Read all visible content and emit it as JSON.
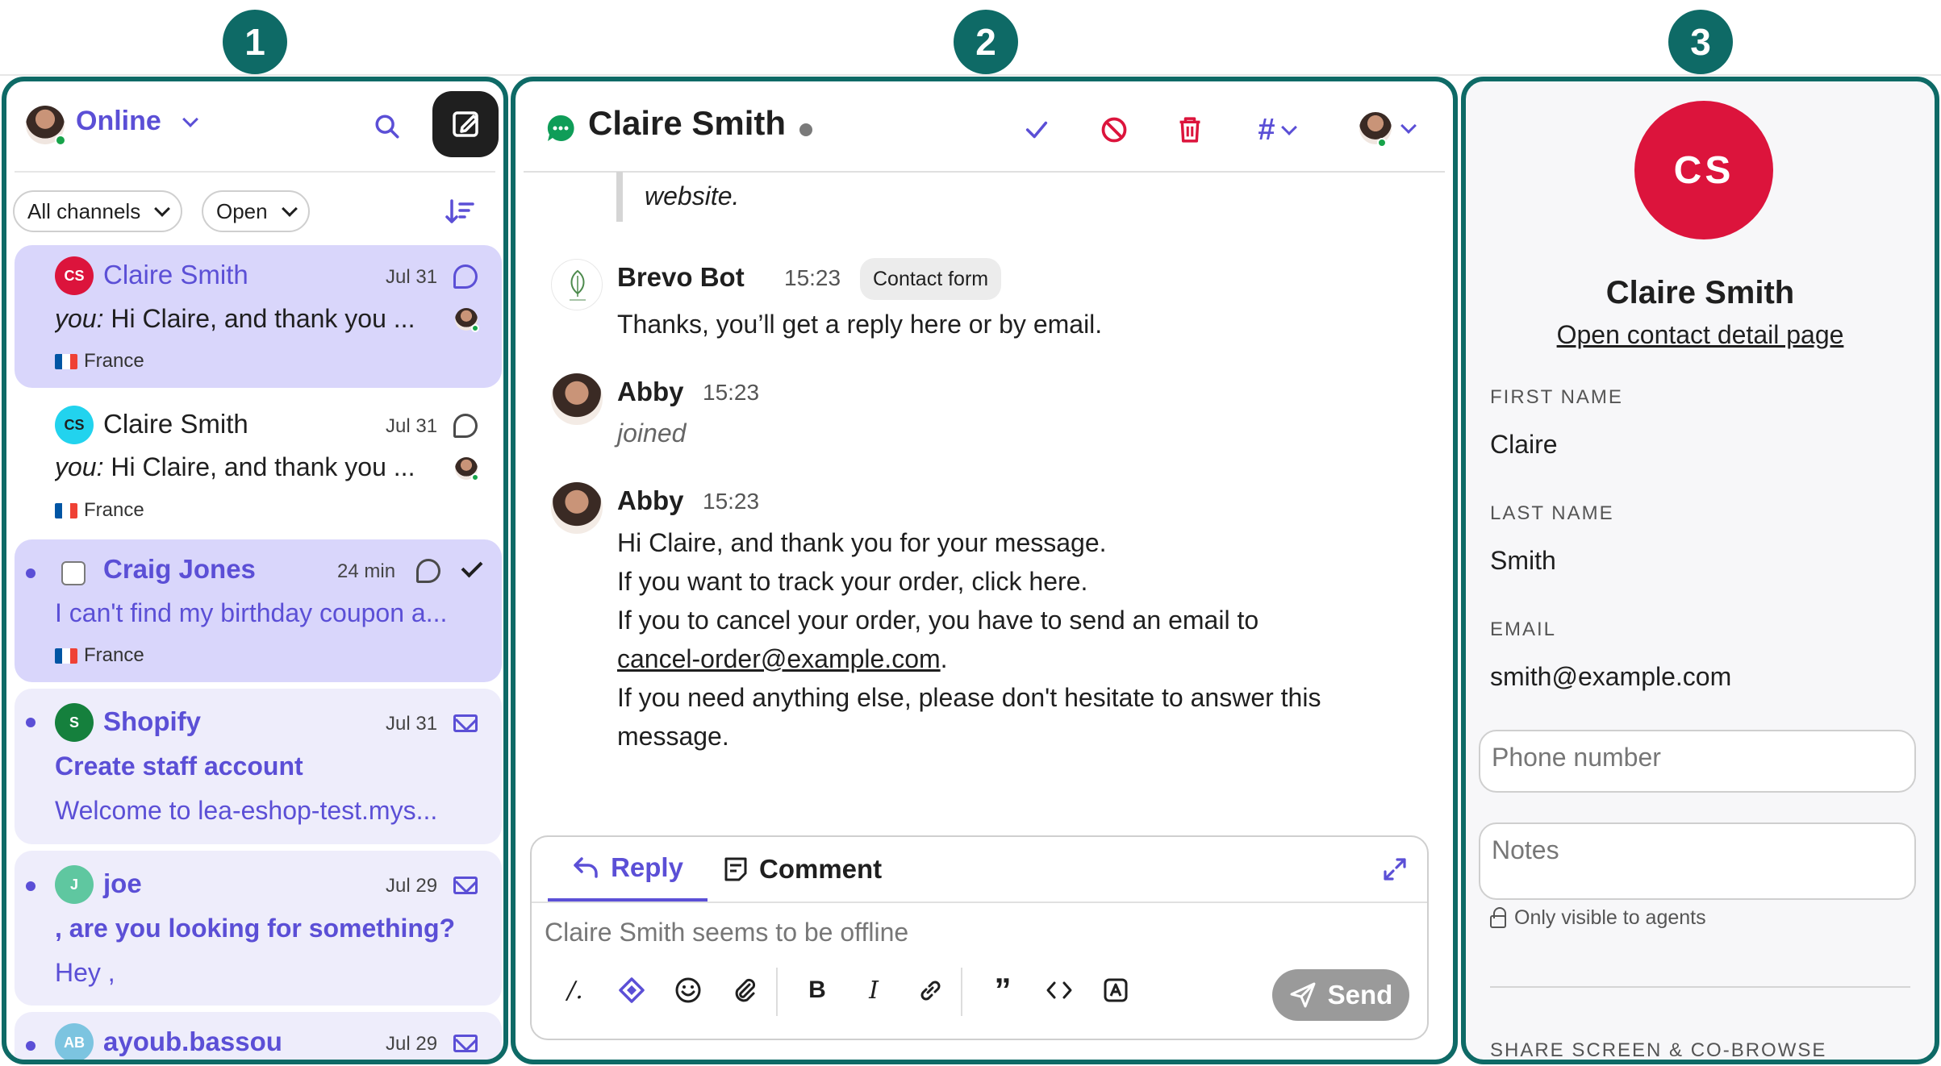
{
  "step_badges": [
    "1",
    "2",
    "3"
  ],
  "inbox": {
    "status": "Online",
    "filters": {
      "channels": "All channels",
      "state": "Open"
    },
    "conversations": [
      {
        "name": "Claire Smith",
        "initials": "CS",
        "avatar_color": "#dc143c",
        "date": "Jul 31",
        "preview_prefix": "you:",
        "preview": "Hi Claire, and thank you ...",
        "country": "France",
        "selected": true
      },
      {
        "name": "Claire Smith",
        "initials": "CS",
        "avatar_color": "#22d3ee",
        "date": "Jul 31",
        "preview_prefix": "you:",
        "preview": "Hi Claire, and thank you ...",
        "country": "France"
      },
      {
        "name": "Craig Jones",
        "date": "24 min",
        "preview": "I can't find my birthday coupon a...",
        "country": "France",
        "unread": true
      },
      {
        "name": "Shopify",
        "initials": "S",
        "avatar_color": "#15803d",
        "date": "Jul 31",
        "subject": "Create staff account",
        "preview": "Welcome to lea-eshop-test.mys...",
        "unread": true
      },
      {
        "name": "joe",
        "initials": "J",
        "avatar_color": "#5fc7a0",
        "date": "Jul 29",
        "subject": ", are you looking for something?",
        "preview": "Hey ,",
        "unread": true
      },
      {
        "name": "ayoub.bassou",
        "initials": "AB",
        "avatar_color": "#7cc4e0",
        "date": "Jul 29",
        "unread": true
      }
    ]
  },
  "chat": {
    "title": "Claire Smith",
    "quote_tail": "website.",
    "messages": [
      {
        "author": "Brevo Bot",
        "time": "15:23",
        "tag": "Contact form",
        "lines": [
          "Thanks, you’ll get a reply here or by email."
        ]
      },
      {
        "author": "Abby",
        "time": "15:23",
        "event": "joined"
      },
      {
        "author": "Abby",
        "time": "15:23",
        "lines": [
          "Hi Claire, and thank you for your message.",
          "If you want to track your order, click here.",
          "If you to cancel your order, you have to send an email to",
          "cancel-order@example.com",
          "If you need anything else, please don't hesitate to answer this",
          "message."
        ]
      }
    ],
    "composer": {
      "tab_reply": "Reply",
      "tab_comment": "Comment",
      "placeholder": "Claire Smith seems to be offline",
      "send": "Send"
    }
  },
  "contact": {
    "initials": "CS",
    "avatar_color": "#dc143c",
    "name": "Claire Smith",
    "detail_link": "Open contact detail page",
    "first_name_label": "FIRST NAME",
    "first_name": "Claire",
    "last_name_label": "LAST NAME",
    "last_name": "Smith",
    "email_label": "EMAIL",
    "email": "smith@example.com",
    "phone_placeholder": "Phone number",
    "notes_placeholder": "Notes",
    "notes_hint": "Only visible to agents",
    "share_label": "SHARE SCREEN & CO-BROWSE"
  },
  "colors": {
    "accent": "#5b4fd6",
    "frame": "#0e6a66",
    "danger": "#dc143c"
  }
}
